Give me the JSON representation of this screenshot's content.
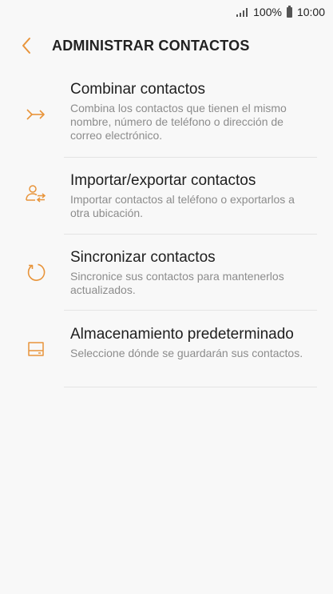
{
  "status_bar": {
    "battery": "100%",
    "time": "10:00"
  },
  "header": {
    "title": "ADMINISTRAR CONTACTOS"
  },
  "accent_color": "#e8943a",
  "items": [
    {
      "icon": "merge-icon",
      "title": "Combinar contactos",
      "description": "Combina los contactos que tienen el mismo nombre, número de teléfono o dirección de correo electrónico."
    },
    {
      "icon": "import-export-icon",
      "title": "Importar/exportar contactos",
      "description": "Importar contactos al teléfono o exportarlos a otra ubicación."
    },
    {
      "icon": "sync-icon",
      "title": "Sincronizar contactos",
      "description": "Sincronice sus contactos para mantenerlos actualizados."
    },
    {
      "icon": "storage-icon",
      "title": "Almacenamiento predeterminado",
      "description": "Seleccione dónde se guardarán sus contactos."
    }
  ]
}
